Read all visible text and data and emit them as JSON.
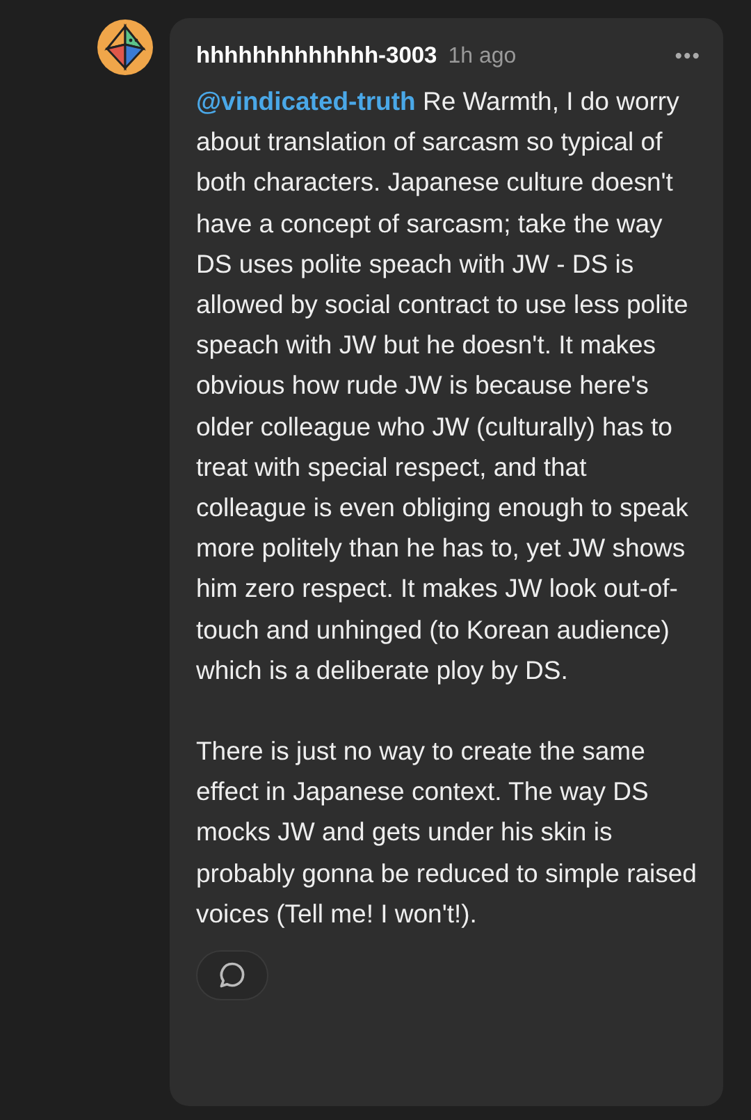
{
  "comment": {
    "author": "hhhhhhhhhhhhh-3003",
    "time": "1h ago",
    "menu": "•••",
    "mention": "@vindicated-truth",
    "paragraphs": [
      "Re Warmth, I do worry about translation of sarcasm so typical of both characters. Japanese culture doesn't have a concept of sarcasm; take the way DS uses polite speach with JW - DS is allowed by social contract to use less polite speach with JW but he doesn't. It makes obvious how rude JW is because here's older colleague who JW (culturally) has to treat with special respect, and that colleague is even obliging enough to speak more politely than he has to, yet JW shows him zero respect. It makes JW look out-of-touch and unhinged (to Korean audience) which is a deliberate ploy by DS.",
      "There is just no way to create the same effect in Japanese context.  The way DS mocks JW and gets under his skin is probably gonna be reduced to simple raised voices (Tell me! I won't!)."
    ]
  }
}
